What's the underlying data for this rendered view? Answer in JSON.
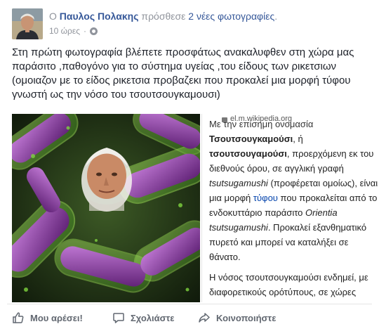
{
  "header": {
    "prefix": "Ο",
    "author": "Παυλος Πολακης",
    "verb": "πρόσθεσε",
    "added": "2 νέες φωτογραφίες",
    "suffix": ".",
    "time": "10 ώρες",
    "separator": "·",
    "privacy_icon": "globe-icon"
  },
  "post": {
    "text": "Στη πρώτη φωτογραφία βλέπετε προσφάτως ανακαλυφθεν στη χώρα μας παράσιτο ,παθογόνο για το σύστημα υγείας ,του είδους των ρικετσιων (ομοιαζον με το είδος ρικετσια προβαζεκι που προκαλεί μια μορφή τύφου γνωστή ως την νόσο του τσουτσουγκαμουσι)"
  },
  "wiki": {
    "url": "el.m.wikipedia.org",
    "line1": "Με την επίσημη ονομασία",
    "term1": "Τσουτσουγκαμούσι",
    "line2": ", ή",
    "term2": "τσουτσουγαμούσι",
    "line3": ", προερχόμενη εκ του διεθνούς όρου, σε αγγλική γραφή",
    "term3": "tsutsugamushi",
    "line4": "(προφέρεται ομοίως), είναι μια μορφή",
    "link1": "τύφου",
    "line5": "που προκαλείται από το ενδοκυττάριο παράσιτο",
    "term4": "Orientia tsutsugamushi",
    "line6": ". Προκαλεί εξανθηματικό πυρετό και μπορεί να καταλήξει σε θάνατο.",
    "para2": "Η νόσος τσουτσουγκαμούσι ενδημεί, με διαφορετικούς ορότύπους, σε χώρες"
  },
  "actions": {
    "like": "Μου αρέσει!",
    "comment": "Σχολιάστε",
    "share": "Κοινοποιήστε",
    "like_icon": "thumbs-up-icon",
    "comment_icon": "comment-bubble-icon",
    "share_icon": "share-arrow-icon"
  },
  "colors": {
    "link": "#365899",
    "meta": "#90949c",
    "text": "#1d2129",
    "action": "#616770"
  }
}
